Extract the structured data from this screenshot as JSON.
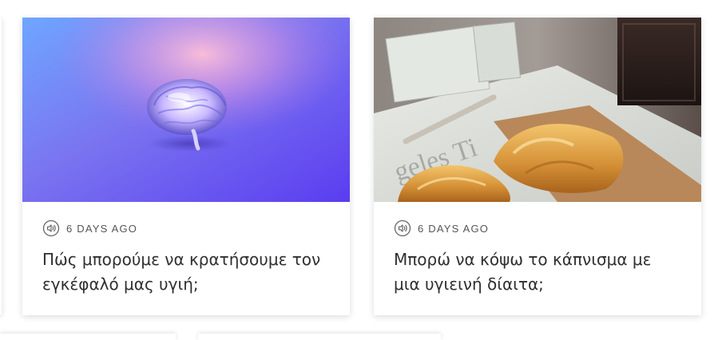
{
  "cards": [
    {
      "image_subject": "brain-image",
      "meta_icon": "audio-icon",
      "date_label": "6 DAYS AGO",
      "title": "Πώς μπορούμε να κρατήσουμε τον εγκέφαλό μας υγιή;"
    },
    {
      "image_subject": "croissant-newspaper-image",
      "meta_icon": "audio-icon",
      "date_label": "6 DAYS AGO",
      "title": "Μπορώ να κόψω το κάπνισμα με μια υγιεινή δίαιτα;"
    }
  ],
  "colors": {
    "gradient_left": "#5b9bff",
    "gradient_right": "#6a3cf2",
    "gradient_glow": "#ff9ccf",
    "meta_text": "#555555",
    "title_text": "#2f2f2f"
  }
}
